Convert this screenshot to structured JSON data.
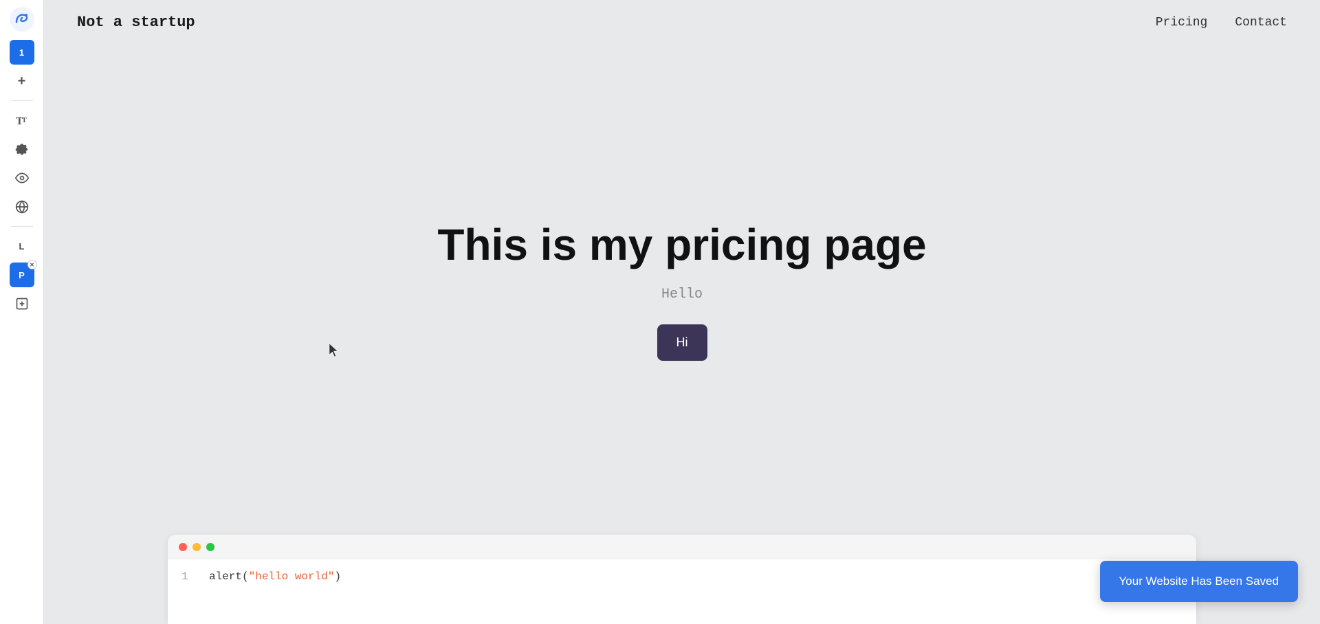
{
  "sidebar": {
    "logo_alt": "unicorn-logo",
    "tab_1": "1",
    "tab_plus": "+",
    "tab_L": "L",
    "tab_P": "P",
    "tab_add": "+"
  },
  "nav": {
    "brand": "Not a startup",
    "links": [
      "Pricing",
      "Contact"
    ]
  },
  "hero": {
    "title": "This is my pricing page",
    "subtitle": "Hello",
    "button_label": "Hi"
  },
  "code": {
    "line_number": "1",
    "code_prefix": "alert(",
    "code_string": "\"hello world\"",
    "code_suffix": ")"
  },
  "toast": {
    "message": "Your Website Has Been Saved"
  }
}
